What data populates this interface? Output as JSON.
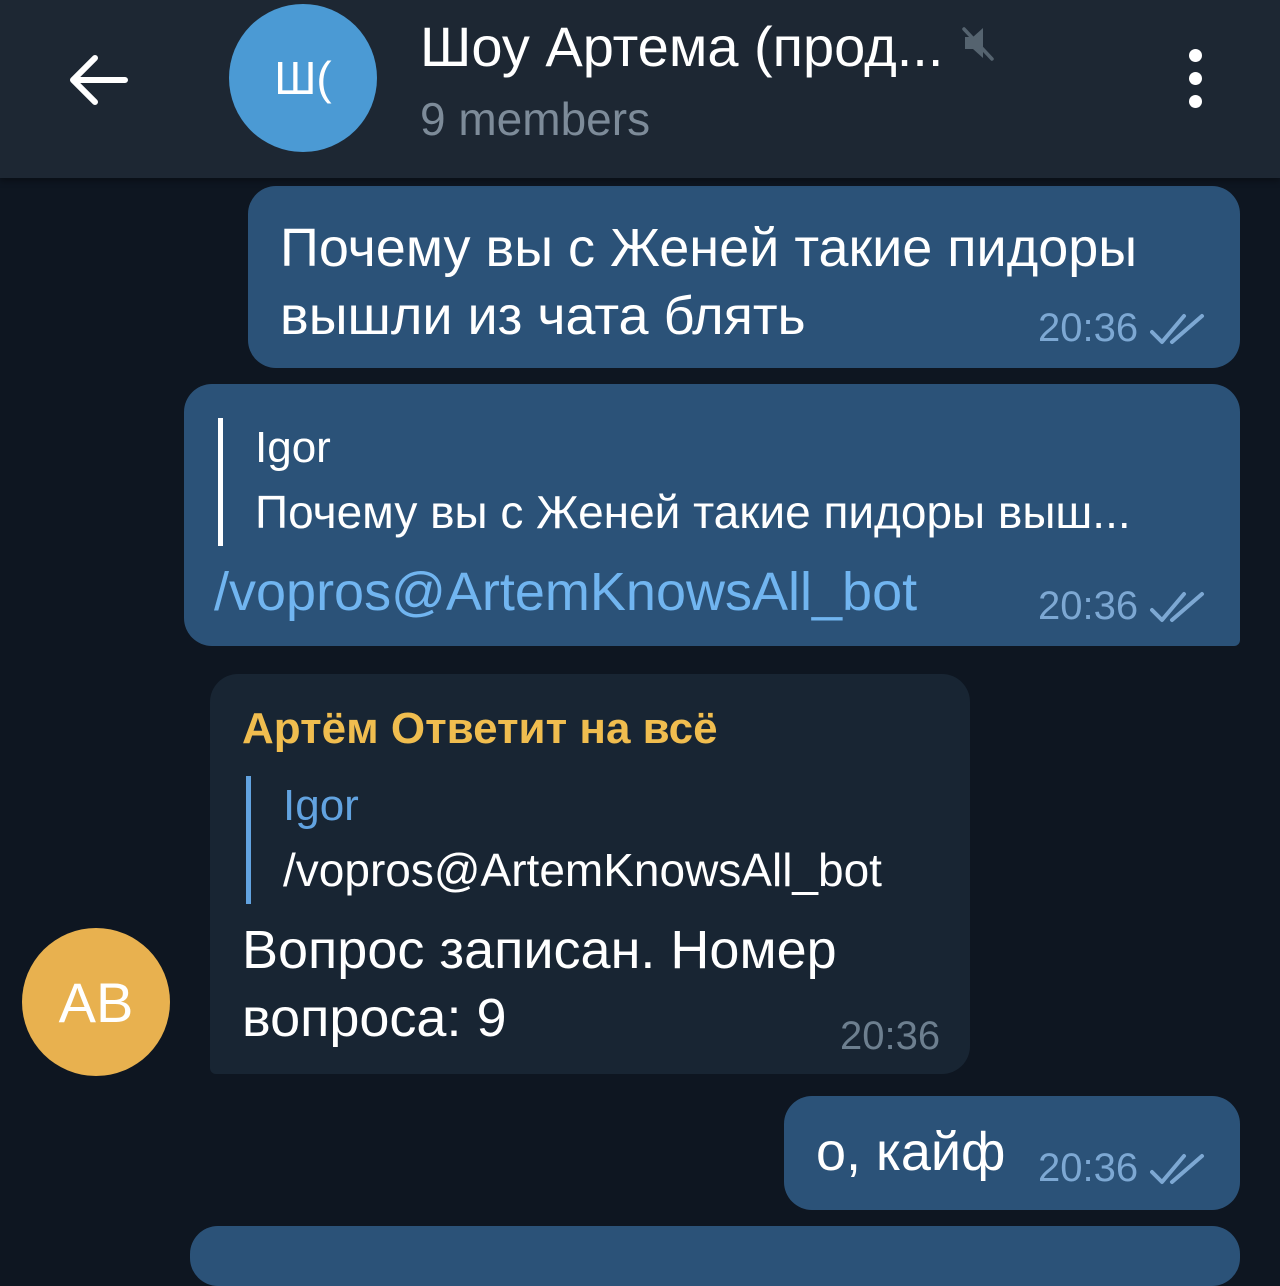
{
  "colors": {
    "accent": "#62a3e0",
    "bubble_out": "#2b5278",
    "bubble_in": "#182533",
    "header_bg": "#1d2733",
    "chat_bg": "#0e1621",
    "sender_name": "#f0bd4f",
    "link": "#71b5f0",
    "reply_bar_out": "#ffffff",
    "reply_bar_in": "#62a3e0"
  },
  "header": {
    "back_icon": "arrow-left-icon",
    "avatar_initials": "Ш(",
    "avatar_color": "#4b9ad4",
    "title": "Шоу Артема (прод...",
    "muted_icon": "mute-icon",
    "subtitle": "9 members",
    "menu_icon": "vertical-dots-icon"
  },
  "messages": [
    {
      "direction": "out",
      "lines": [
        "Почему вы с Женей такие пидоры",
        "вышли из чата блять"
      ],
      "time": "20:36",
      "status_icon": "double-check-icon"
    },
    {
      "direction": "out",
      "reply": {
        "name": "Igor",
        "text": "Почему вы с Женей такие пидоры выш..."
      },
      "text": "/vopros@ArtemKnowsAll_bot",
      "time": "20:36",
      "status_icon": "double-check-icon"
    },
    {
      "direction": "in",
      "sender": "Артём Ответит на всё",
      "sender_initials": "AB",
      "sender_avatar_color": "#e8b14f",
      "reply": {
        "name": "Igor",
        "text": "/vopros@ArtemKnowsAll_bot"
      },
      "lines": [
        "Вопрос записан. Номер",
        "вопроса: 9"
      ],
      "time": "20:36"
    },
    {
      "direction": "out",
      "text": "о, кайф",
      "time": "20:36",
      "status_icon": "double-check-icon"
    }
  ]
}
